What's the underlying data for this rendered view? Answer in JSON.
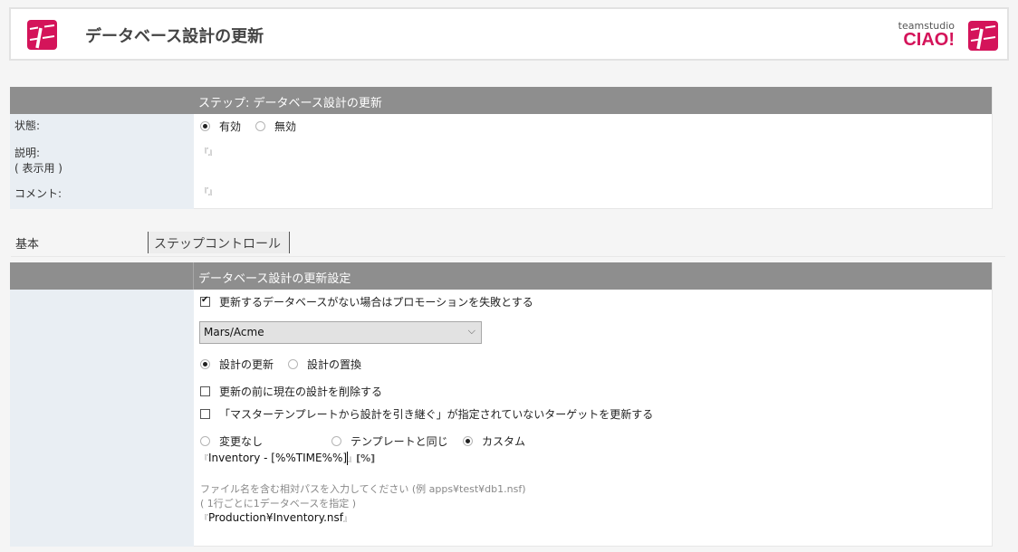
{
  "header": {
    "title": "データベース設計の更新",
    "brand_small": "teamstudio",
    "brand_name": "CIAO!",
    "brand_color": "#d4145a"
  },
  "step_panel": {
    "title": "ステップ: データベース設計の更新",
    "status_label": "状態:",
    "status_options": [
      {
        "label": "有効",
        "selected": true
      },
      {
        "label": "無効",
        "selected": false
      }
    ],
    "description_label": "説明:",
    "description_sub": "( 表示用 )",
    "description_value": "",
    "comment_label": "コメント:",
    "comment_value": ""
  },
  "tabs": [
    {
      "label": "基本",
      "active": true
    },
    {
      "label": "ステップコントロール",
      "active": false
    }
  ],
  "settings_panel": {
    "title": "データベース設計の更新設定",
    "fail_if_missing": {
      "label": "更新するデータベースがない場合はプロモーションを失敗とする",
      "checked": true
    },
    "server_select": {
      "value": "Mars/Acme"
    },
    "design_mode": [
      {
        "label": "設計の更新",
        "selected": true
      },
      {
        "label": "設計の置換",
        "selected": false
      }
    ],
    "delete_before": {
      "label": "更新の前に現在の設計を削除する",
      "checked": false
    },
    "update_non_inherit": {
      "label": "「マスターテンプレートから設計を引き継ぐ」が指定されていないターゲットを更新する",
      "checked": false
    },
    "title_mode": [
      {
        "label": "変更なし",
        "selected": false
      },
      {
        "label": "テンプレートと同じ",
        "selected": false
      },
      {
        "label": "カスタム",
        "selected": true
      }
    ],
    "custom_title": "Inventory - [%%TIME%%]",
    "format_button": "[%]",
    "path_hint": "ファイル名を含む相対パスを入力してください (例 apps¥test¥db1.nsf)",
    "path_hint2": "( 1行ごとに1データベースを指定 )",
    "path_value": "Production¥Inventory.nsf"
  },
  "icons": {
    "bracket_open": "『",
    "bracket_close": "』",
    "chevron": "⌵"
  }
}
